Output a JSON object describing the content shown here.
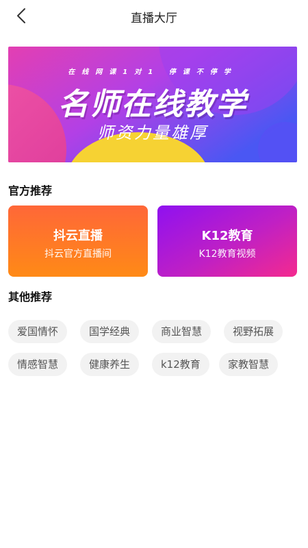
{
  "header": {
    "title": "直播大厅"
  },
  "banner": {
    "small_text": "在线网课1对1 停课不停学",
    "main_text": "名师在线教学",
    "sub_text": "师资力量雄厚"
  },
  "official": {
    "title": "官方推荐",
    "cards": [
      {
        "title": "抖云直播",
        "subtitle": "抖云官方直播间"
      },
      {
        "title": "K12教育",
        "subtitle": "K12教育视频"
      }
    ]
  },
  "others": {
    "title": "其他推荐",
    "tags": [
      "爱国情怀",
      "国学经典",
      "商业智慧",
      "视野拓展",
      "情感智慧",
      "健康养生",
      "k12教育",
      "家教智慧"
    ]
  },
  "colors": {
    "card_orange": "#ff7a28",
    "card_purple": "#b01fd0",
    "tag_bg": "#f2f2f2"
  }
}
